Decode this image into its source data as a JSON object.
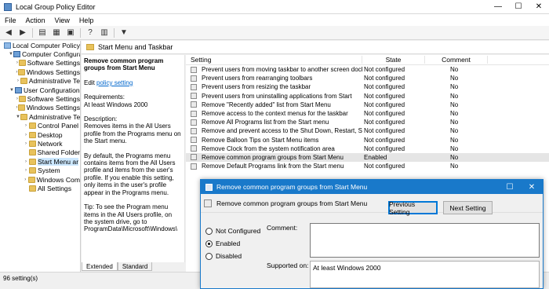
{
  "window": {
    "title": "Local Group Policy Editor",
    "controls": [
      "—",
      "☐",
      "✕"
    ]
  },
  "menu": [
    "File",
    "Action",
    "View",
    "Help"
  ],
  "tree": [
    {
      "label": "Local Computer Policy",
      "depth": 0,
      "exp": "",
      "icon": "policy"
    },
    {
      "label": "Computer Configura",
      "depth": 1,
      "exp": "▼",
      "icon": "computer"
    },
    {
      "label": "Software Settings",
      "depth": 2,
      "exp": "›",
      "icon": "folder"
    },
    {
      "label": "Windows Settings",
      "depth": 2,
      "exp": "›",
      "icon": "folder"
    },
    {
      "label": "Administrative Te",
      "depth": 2,
      "exp": "›",
      "icon": "folder"
    },
    {
      "label": "User Configuration",
      "depth": 1,
      "exp": "▼",
      "icon": "computer"
    },
    {
      "label": "Software Settings",
      "depth": 2,
      "exp": "›",
      "icon": "folder"
    },
    {
      "label": "Windows Settings",
      "depth": 2,
      "exp": "›",
      "icon": "folder"
    },
    {
      "label": "Administrative Te",
      "depth": 2,
      "exp": "▼",
      "icon": "folder"
    },
    {
      "label": "Control Panel",
      "depth": 3,
      "exp": "›",
      "icon": "folder"
    },
    {
      "label": "Desktop",
      "depth": 3,
      "exp": "›",
      "icon": "folder"
    },
    {
      "label": "Network",
      "depth": 3,
      "exp": "›",
      "icon": "folder"
    },
    {
      "label": "Shared Folder",
      "depth": 3,
      "exp": "",
      "icon": "folder"
    },
    {
      "label": "Start Menu ar",
      "depth": 3,
      "exp": "›",
      "icon": "folder",
      "selected": true
    },
    {
      "label": "System",
      "depth": 3,
      "exp": "›",
      "icon": "folder"
    },
    {
      "label": "Windows Com",
      "depth": 3,
      "exp": "›",
      "icon": "folder"
    },
    {
      "label": "All Settings",
      "depth": 3,
      "exp": "",
      "icon": "folder"
    }
  ],
  "section_title": "Start Menu and Taskbar",
  "description": {
    "title": "Remove common program groups from Start Menu",
    "edit_prefix": "Edit",
    "edit_link": "policy setting",
    "requirements": "Requirements:",
    "requirements_value": "At least Windows 2000",
    "desc_label": "Description:",
    "desc_text": "Removes items in the All Users profile from the Programs menu on the Start menu.",
    "para2": "By default, the Programs menu contains items from the All Users profile and items from the user's profile. If you enable this setting, only items in the user's profile appear in the Programs menu.",
    "para3": "Tip: To see the Program menu items in the All Users profile, on the system drive, go to ProgramData\\Microsoft\\Windows\\"
  },
  "tabs": [
    "Extended",
    "Standard"
  ],
  "columns": {
    "setting": "Setting",
    "state": "State",
    "comment": "Comment"
  },
  "rows": [
    {
      "setting": "Prevent users from moving taskbar to another screen dock l...",
      "state": "Not configured",
      "comment": "No"
    },
    {
      "setting": "Prevent users from rearranging toolbars",
      "state": "Not configured",
      "comment": "No"
    },
    {
      "setting": "Prevent users from resizing the taskbar",
      "state": "Not configured",
      "comment": "No"
    },
    {
      "setting": "Prevent users from uninstalling applications from Start",
      "state": "Not configured",
      "comment": "No"
    },
    {
      "setting": "Remove \"Recently added\" list from Start Menu",
      "state": "Not configured",
      "comment": "No"
    },
    {
      "setting": "Remove access to the context menus for the taskbar",
      "state": "Not configured",
      "comment": "No"
    },
    {
      "setting": "Remove All Programs list from the Start menu",
      "state": "Not configured",
      "comment": "No"
    },
    {
      "setting": "Remove and prevent access to the Shut Down, Restart, Sleep...",
      "state": "Not configured",
      "comment": "No"
    },
    {
      "setting": "Remove Balloon Tips on Start Menu items",
      "state": "Not configured",
      "comment": "No"
    },
    {
      "setting": "Remove Clock from the system notification area",
      "state": "Not configured",
      "comment": "No"
    },
    {
      "setting": "Remove common program groups from Start Menu",
      "state": "Enabled",
      "comment": "No",
      "selected": true
    },
    {
      "setting": "Remove Default Programs link from the Start menu",
      "state": "Not configured",
      "comment": "No"
    }
  ],
  "status": "96 setting(s)",
  "dialog": {
    "title": "Remove common program groups from Start Menu",
    "subtitle": "Remove common program groups from Start Menu",
    "prev_button": "Previous Setting",
    "next_button": "Next Setting",
    "options": [
      "Not Configured",
      "Enabled",
      "Disabled"
    ],
    "selected_option": "Enabled",
    "comment_label": "Comment:",
    "supported_label": "Supported on:",
    "supported_value": "At least Windows 2000"
  }
}
